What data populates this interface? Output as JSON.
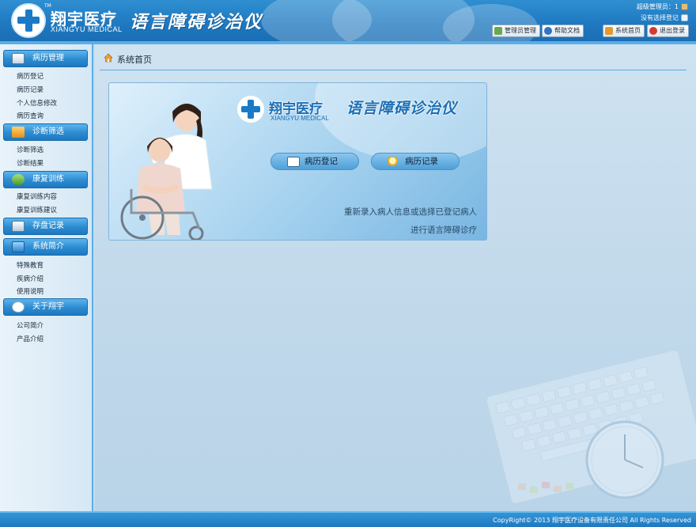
{
  "header": {
    "logo_cn": "翔宇医疗",
    "logo_en": "XIANGYU MEDICAL",
    "logo_tm": "TM",
    "app_title": "语言障碍诊治仪",
    "user_text": "超级管理员：1",
    "role_text": "没有选择登记",
    "buttons": [
      {
        "label": "管理员管理",
        "icon": "admin-icon"
      },
      {
        "label": "帮助文档",
        "icon": "help-icon"
      },
      {
        "label": "系统首页",
        "icon": "home-icon"
      },
      {
        "label": "退出登录",
        "icon": "logout-icon"
      }
    ]
  },
  "sidebar": {
    "sections": [
      {
        "title": "病历管理",
        "icon": "medical-record-icon",
        "items": [
          "病历登记",
          "病历记录",
          "个人信息修改",
          "病历查询"
        ]
      },
      {
        "title": "诊断筛选",
        "icon": "diagnosis-icon",
        "items": [
          "诊断筛选",
          "诊断结果"
        ]
      },
      {
        "title": "康复训练",
        "icon": "rehab-icon",
        "items": [
          "康复训练内容",
          "康复训练建议"
        ]
      },
      {
        "title": "存盘记录",
        "icon": "save-record-icon",
        "items": []
      },
      {
        "title": "系统简介",
        "icon": "monitor-icon",
        "items": [
          "特殊教育",
          "疾病介绍",
          "使用说明"
        ]
      },
      {
        "title": "关于翔宇",
        "icon": "chat-bubble-icon",
        "items": [
          "公司简介",
          "产品介绍"
        ]
      }
    ]
  },
  "main": {
    "breadcrumb": "系统首页",
    "card": {
      "logo_cn": "翔宇医疗",
      "logo_en": "XIANGYU MEDICAL",
      "title": "语言障碍诊治仪",
      "buttons": [
        {
          "label": "病历登记",
          "icon": "id-card-icon"
        },
        {
          "label": "病历记录",
          "icon": "magnifier-icon"
        }
      ],
      "desc1": "重新录入病人信息或选择已登记病人",
      "desc2": "进行语言障碍诊疗"
    }
  },
  "footer": {
    "copyright": "CopyRight© 2013 翔宇医疗设备有限责任公司 All Rights Reserved"
  },
  "colors": {
    "header_blue": "#1f78c0",
    "accent_blue": "#5aaee6",
    "main_bg": "#c5dced"
  }
}
